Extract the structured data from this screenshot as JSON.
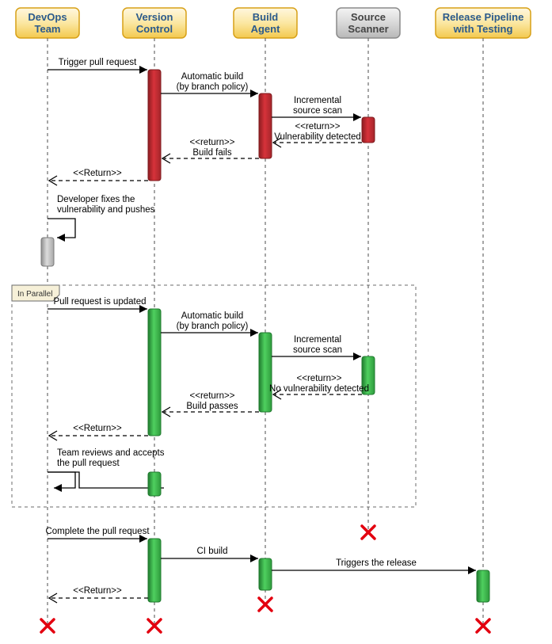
{
  "participants": [
    {
      "id": "devops",
      "line1": "DevOps",
      "line2": "Team",
      "style": "gold"
    },
    {
      "id": "vcs",
      "line1": "Version",
      "line2": "Control",
      "style": "gold"
    },
    {
      "id": "build",
      "line1": "Build",
      "line2": "Agent",
      "style": "gold"
    },
    {
      "id": "scanner",
      "line1": "Source",
      "line2": "Scanner",
      "style": "grey"
    },
    {
      "id": "release",
      "line1": "Release Pipeline",
      "line2": "with Testing",
      "style": "gold"
    }
  ],
  "fragment": {
    "label": "In Parallel"
  },
  "messages": {
    "m1": "Trigger pull request",
    "m2a": "Automatic build",
    "m2b": "(by branch policy)",
    "m3a": "Incremental",
    "m3b": "source scan",
    "m4a": "<<return>>",
    "m4b": "Vulnerability detected",
    "m5a": "<<return>>",
    "m5b": "Build fails",
    "m6": "<<Return>>",
    "self1a": "Developer fixes the",
    "self1b": "vulnerability and pushes",
    "m7": "Pull request is updated",
    "m8a": "Automatic build",
    "m8b": "(by branch policy)",
    "m9a": "Incremental",
    "m9b": "source scan",
    "m10a": "<<return>>",
    "m10b": "No vulnerability detected",
    "m11a": "<<return>>",
    "m11b": "Build passes",
    "m12": "<<Return>>",
    "self2a": "Team reviews and accepts",
    "self2b": "the pull request",
    "m13": "Complete the pull request",
    "m14": "CI build",
    "m15": "Triggers the release",
    "m16": "<<Return>>"
  },
  "chart_data": {
    "type": "sequence_diagram",
    "participants": [
      "DevOps Team",
      "Version Control",
      "Build Agent",
      "Source Scanner",
      "Release Pipeline with Testing"
    ],
    "fragments": [
      {
        "label": "In Parallel",
        "covers": [
          "DevOps Team",
          "Version Control",
          "Build Agent",
          "Source Scanner"
        ],
        "contains_indices": [
          7,
          8,
          9,
          10,
          11,
          12,
          13
        ]
      }
    ],
    "interactions": [
      {
        "from": "DevOps Team",
        "to": "Version Control",
        "label": "Trigger pull request",
        "kind": "sync"
      },
      {
        "from": "Version Control",
        "to": "Build Agent",
        "label": "Automatic build (by branch policy)",
        "kind": "sync"
      },
      {
        "from": "Build Agent",
        "to": "Source Scanner",
        "label": "Incremental source scan",
        "kind": "sync"
      },
      {
        "from": "Source Scanner",
        "to": "Build Agent",
        "label": "<<return>> Vulnerability detected",
        "kind": "return",
        "status": "fail"
      },
      {
        "from": "Build Agent",
        "to": "Version Control",
        "label": "<<return>> Build fails",
        "kind": "return",
        "status": "fail"
      },
      {
        "from": "Version Control",
        "to": "DevOps Team",
        "label": "<<Return>>",
        "kind": "return"
      },
      {
        "from": "DevOps Team",
        "to": "DevOps Team",
        "label": "Developer fixes the vulnerability and pushes",
        "kind": "self"
      },
      {
        "from": "DevOps Team",
        "to": "Version Control",
        "label": "Pull request is updated",
        "kind": "sync"
      },
      {
        "from": "Version Control",
        "to": "Build Agent",
        "label": "Automatic build (by branch policy)",
        "kind": "sync"
      },
      {
        "from": "Build Agent",
        "to": "Source Scanner",
        "label": "Incremental source scan",
        "kind": "sync"
      },
      {
        "from": "Source Scanner",
        "to": "Build Agent",
        "label": "<<return>> No vulnerability detected",
        "kind": "return",
        "status": "pass"
      },
      {
        "from": "Build Agent",
        "to": "Version Control",
        "label": "<<return>> Build passes",
        "kind": "return",
        "status": "pass"
      },
      {
        "from": "Version Control",
        "to": "DevOps Team",
        "label": "<<Return>>",
        "kind": "return"
      },
      {
        "from": "DevOps Team",
        "to": "DevOps Team",
        "label": "Team reviews and accepts the pull request",
        "kind": "self"
      },
      {
        "from": "DevOps Team",
        "to": "Version Control",
        "label": "Complete the pull request",
        "kind": "sync"
      },
      {
        "from": "Version Control",
        "to": "Build Agent",
        "label": "CI build",
        "kind": "sync"
      },
      {
        "from": "Build Agent",
        "to": "Release Pipeline with Testing",
        "label": "Triggers the release",
        "kind": "sync"
      },
      {
        "from": "Version Control",
        "to": "DevOps Team",
        "label": "<<Return>>",
        "kind": "return"
      }
    ],
    "terminations": [
      "DevOps Team",
      "Version Control",
      "Build Agent",
      "Source Scanner",
      "Release Pipeline with Testing"
    ]
  }
}
